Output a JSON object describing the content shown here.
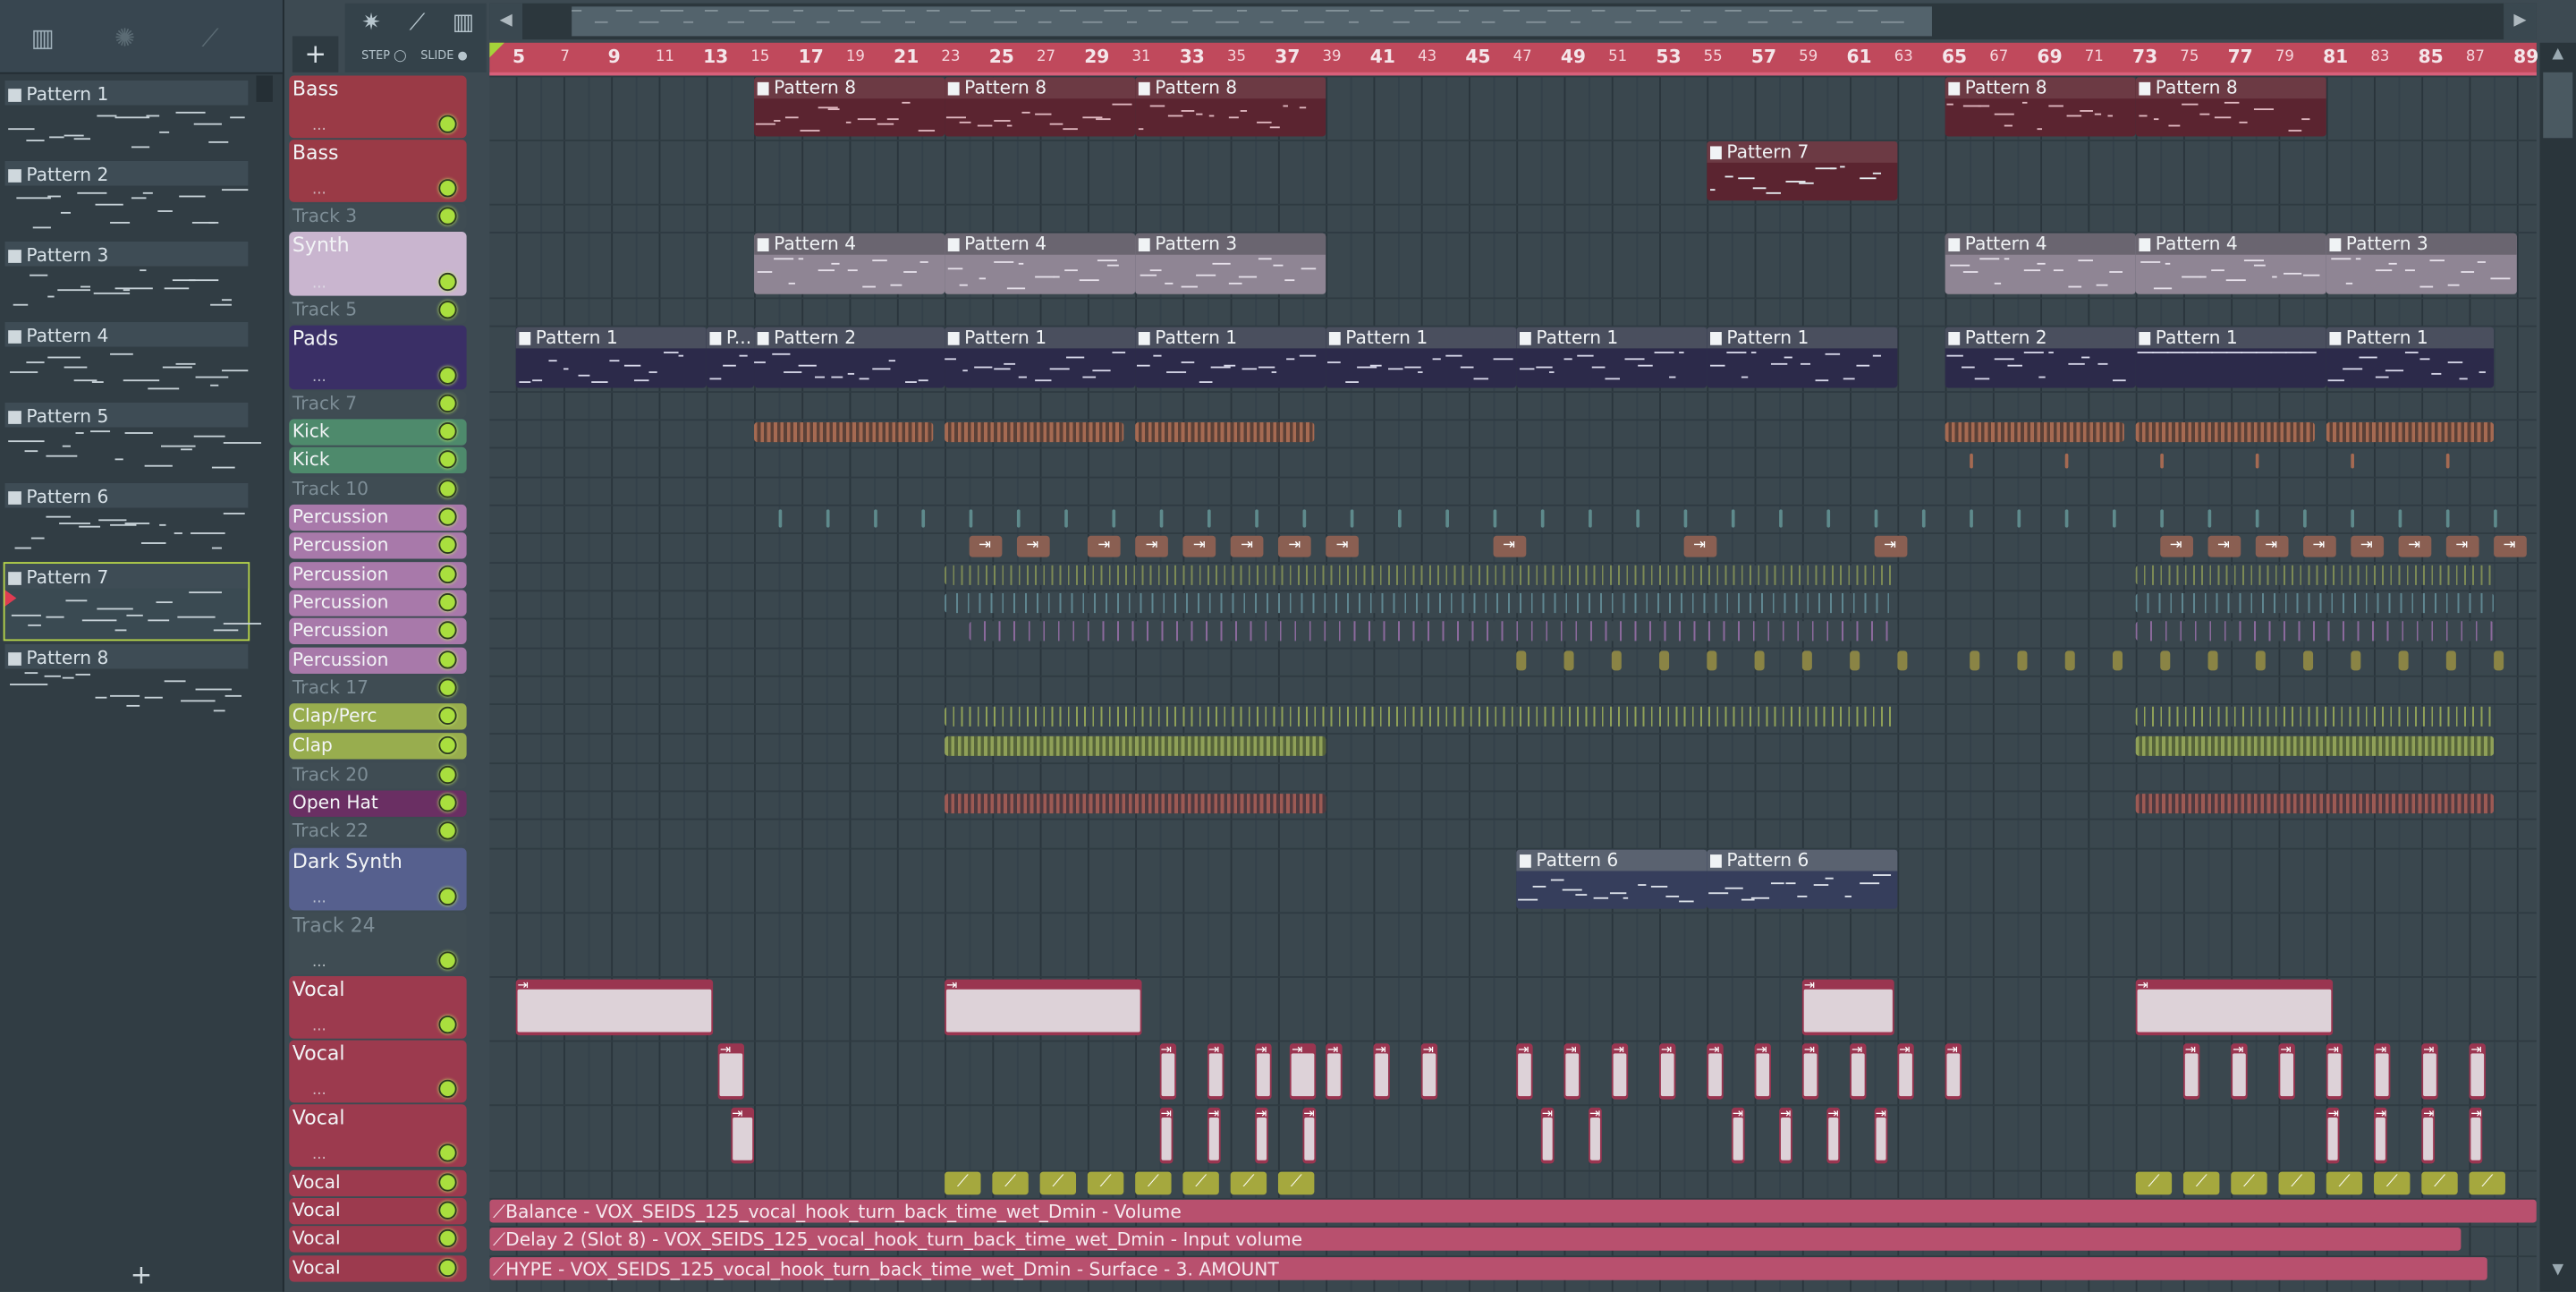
{
  "picker": {
    "patterns": [
      {
        "label": "Pattern 1"
      },
      {
        "label": "Pattern 2"
      },
      {
        "label": "Pattern 3"
      },
      {
        "label": "Pattern 4"
      },
      {
        "label": "Pattern 5"
      },
      {
        "label": "Pattern 6"
      },
      {
        "label": "Pattern 7"
      },
      {
        "label": "Pattern 8"
      }
    ],
    "add_symbol": "+"
  },
  "toolbar": {
    "add_track": "+",
    "step_label": "STEP",
    "slide_label": "SLIDE"
  },
  "ruler": {
    "bars": [
      "5",
      "7",
      "9",
      "11",
      "13",
      "15",
      "17",
      "19",
      "21",
      "23",
      "25",
      "27",
      "29",
      "31",
      "33",
      "35",
      "37",
      "39",
      "41",
      "43",
      "45",
      "47",
      "49",
      "51",
      "53",
      "55",
      "57",
      "59",
      "61",
      "63",
      "65",
      "67",
      "69",
      "71",
      "73",
      "75",
      "77",
      "79",
      "81",
      "83",
      "85",
      "87",
      "89"
    ]
  },
  "tracks": [
    {
      "name": "Bass",
      "color": "#9a3a46",
      "tall": true
    },
    {
      "name": "Bass",
      "color": "#9a3a46",
      "tall": true
    },
    {
      "name": "Track 3",
      "ghost": true
    },
    {
      "name": "Synth",
      "color": "#c9b5cf",
      "tall": true
    },
    {
      "name": "Track 5",
      "ghost": true
    },
    {
      "name": "Pads",
      "color": "#3a2f66",
      "tall": true
    },
    {
      "name": "Track 7",
      "ghost": true
    },
    {
      "name": "Kick",
      "color": "#4e8a6c"
    },
    {
      "name": "Kick",
      "color": "#4e8a6c"
    },
    {
      "name": "Track 10",
      "ghost": true
    },
    {
      "name": "Percussion",
      "color": "#a879aa"
    },
    {
      "name": "Percussion",
      "color": "#a879aa"
    },
    {
      "name": "Percussion",
      "color": "#a879aa"
    },
    {
      "name": "Percussion",
      "color": "#a879aa"
    },
    {
      "name": "Percussion",
      "color": "#a879aa"
    },
    {
      "name": "Percussion",
      "color": "#a879aa"
    },
    {
      "name": "Track 17",
      "ghost": true
    },
    {
      "name": "Clap/Perc",
      "color": "#98ad4e"
    },
    {
      "name": "Clap",
      "color": "#98ad4e"
    },
    {
      "name": "Track 20",
      "ghost": true
    },
    {
      "name": "Open Hat",
      "color": "#6a2f63"
    },
    {
      "name": "Track 22",
      "ghost": true
    },
    {
      "name": "Dark Synth",
      "color": "#56608e",
      "tall": true
    },
    {
      "name": "Track 24",
      "ghost": true,
      "tall": true
    },
    {
      "name": "Vocal",
      "color": "#9c3a4e",
      "tall": true
    },
    {
      "name": "Vocal",
      "color": "#9c3a4e",
      "tall": true
    },
    {
      "name": "Vocal",
      "color": "#9c3a4e",
      "tall": true
    },
    {
      "name": "Vocal",
      "color": "#9c3a4e"
    },
    {
      "name": "Vocal",
      "color": "#9c3a4e"
    },
    {
      "name": "Vocal",
      "color": "#9c3a4e"
    },
    {
      "name": "Vocal",
      "color": "#9c3a4e"
    }
  ],
  "clips": {
    "bass1": [
      "Pattern 8",
      "Pattern 8",
      "Pattern 8",
      "Pattern 8",
      "Pattern 8"
    ],
    "bass2": [
      "Pattern 7"
    ],
    "synth": [
      "Pattern 4",
      "Pattern 4",
      "Pattern 3",
      "Pattern 4",
      "Pattern 4",
      "Pattern 3"
    ],
    "pads": [
      "Pattern 1",
      "P...",
      "Pattern 2",
      "Pattern 1",
      "Pattern 1",
      "Pattern 1",
      "Pattern 1",
      "Pattern 1",
      "Pattern 2",
      "Pattern 1",
      "Pattern 1"
    ],
    "dark_synth": [
      "Pattern 6",
      "Pattern 6"
    ]
  },
  "automation": [
    {
      "label": "Balance - VOX_SEIDS_125_vocal_hook_turn_back_time_wet_Dmin - Volume"
    },
    {
      "label": "Delay 2 (Slot 8) - VOX_SEIDS_125_vocal_hook_turn_back_time_wet_Dmin - Input volume"
    },
    {
      "label": "HYPE - VOX_SEIDS_125_vocal_hook_turn_back_time_wet_Dmin - Surface - 3. AMOUNT"
    }
  ]
}
